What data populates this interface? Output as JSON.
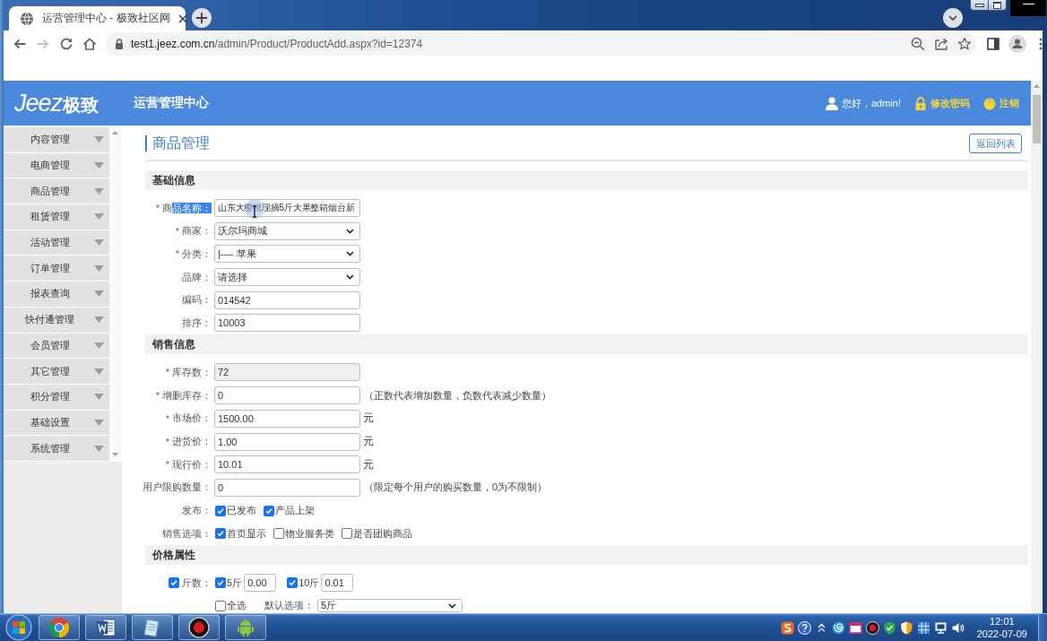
{
  "browser": {
    "tab": {
      "title": "运营管理中心 - 极致社区网"
    },
    "nav": {
      "forward_disabled": true
    },
    "url": {
      "host": "test1.jeez.com.cn",
      "path": "/admin/Product/ProductAdd.aspx?id=12374"
    }
  },
  "header": {
    "logo": {
      "word": "Jeez",
      "mark": "极致"
    },
    "title": "运营管理中心",
    "greeting": "您好，admin!",
    "links": [
      {
        "kind": "lock",
        "label": "修改密码"
      },
      {
        "kind": "power",
        "label": "注销"
      }
    ]
  },
  "sidebar": {
    "items": [
      "内容管理",
      "电商管理",
      "商品管理",
      "租赁管理",
      "活动管理",
      "订单管理",
      "报表查询",
      "快付通管理",
      "会员管理",
      "其它管理",
      "积分管理",
      "基础设置",
      "系统管理"
    ]
  },
  "page": {
    "title": "商品管理",
    "back_button": "返回列表"
  },
  "sections": [
    {
      "title": "基础信息",
      "rows": [
        {
          "kind": "input",
          "required_mark": "*",
          "label": "商",
          "selected_text": "品名称：",
          "value": "山东大樱桃现摘5斤大果整箱烟台新",
          "disabled": false
        },
        {
          "kind": "select",
          "required_mark": "*",
          "label": "商家：",
          "value": "沃尔玛商城"
        },
        {
          "kind": "select",
          "required_mark": "*",
          "label": "分类：",
          "value": "|---- 苹果"
        },
        {
          "kind": "select",
          "label": "品牌：",
          "value": "请选择"
        },
        {
          "kind": "input",
          "label": "编码：",
          "value": "014542",
          "disabled": false
        },
        {
          "kind": "input",
          "label": "排序：",
          "value": "10003",
          "disabled": false
        }
      ]
    },
    {
      "title": "销售信息",
      "rows": [
        {
          "kind": "input",
          "required_mark": "*",
          "label": "库存数：",
          "value": "72",
          "disabled": true
        },
        {
          "kind": "input",
          "required_mark": "*",
          "label": "增删库存：",
          "value": "0",
          "disabled": false,
          "note": "（正数代表增加数量，负数代表减少数量）"
        },
        {
          "kind": "input",
          "required_mark": "*",
          "label": "市场价：",
          "value": "1500.00",
          "disabled": false,
          "unit": "元"
        },
        {
          "kind": "input",
          "required_mark": "*",
          "label": "进货价：",
          "value": "1.00",
          "disabled": false,
          "unit": "元"
        },
        {
          "kind": "input",
          "required_mark": "*",
          "label": "现行价：",
          "value": "10.01",
          "disabled": false,
          "unit": "元"
        },
        {
          "kind": "input",
          "label": "用户限购数量：",
          "value": "0",
          "disabled": false,
          "note": "（限定每个用户的购买数量，0为不限制）"
        },
        {
          "kind": "checks",
          "label": "发布：",
          "options": [
            {
              "label": "已发布",
              "checked": true
            },
            {
              "label": "产品上架",
              "checked": true
            }
          ]
        },
        {
          "kind": "checks",
          "label": "销售选项：",
          "options": [
            {
              "label": "首页显示",
              "checked": true
            },
            {
              "label": "物业服务类",
              "checked": false
            },
            {
              "label": "是否团购商品",
              "checked": false
            }
          ]
        }
      ]
    },
    {
      "title": "价格属性",
      "rows": [
        {
          "kind": "weights",
          "checked": true,
          "label": "斤数：",
          "options": [
            {
              "label": "5斤",
              "checked": true,
              "value": "0.00"
            },
            {
              "label": "10斤",
              "checked": true,
              "value": "0.01"
            }
          ]
        },
        {
          "kind": "default",
          "options": [
            {
              "label": "全选",
              "checked": false
            }
          ],
          "label": "默认选项：",
          "value": "5斤"
        }
      ]
    }
  ],
  "taskbar": {
    "apps": [
      {
        "kind": "browser"
      },
      {
        "kind": "word"
      },
      {
        "kind": "notes"
      },
      {
        "kind": "recorder"
      },
      {
        "kind": "robot"
      }
    ],
    "clock": {
      "time": "12:01",
      "date": "2022-07-09"
    }
  }
}
